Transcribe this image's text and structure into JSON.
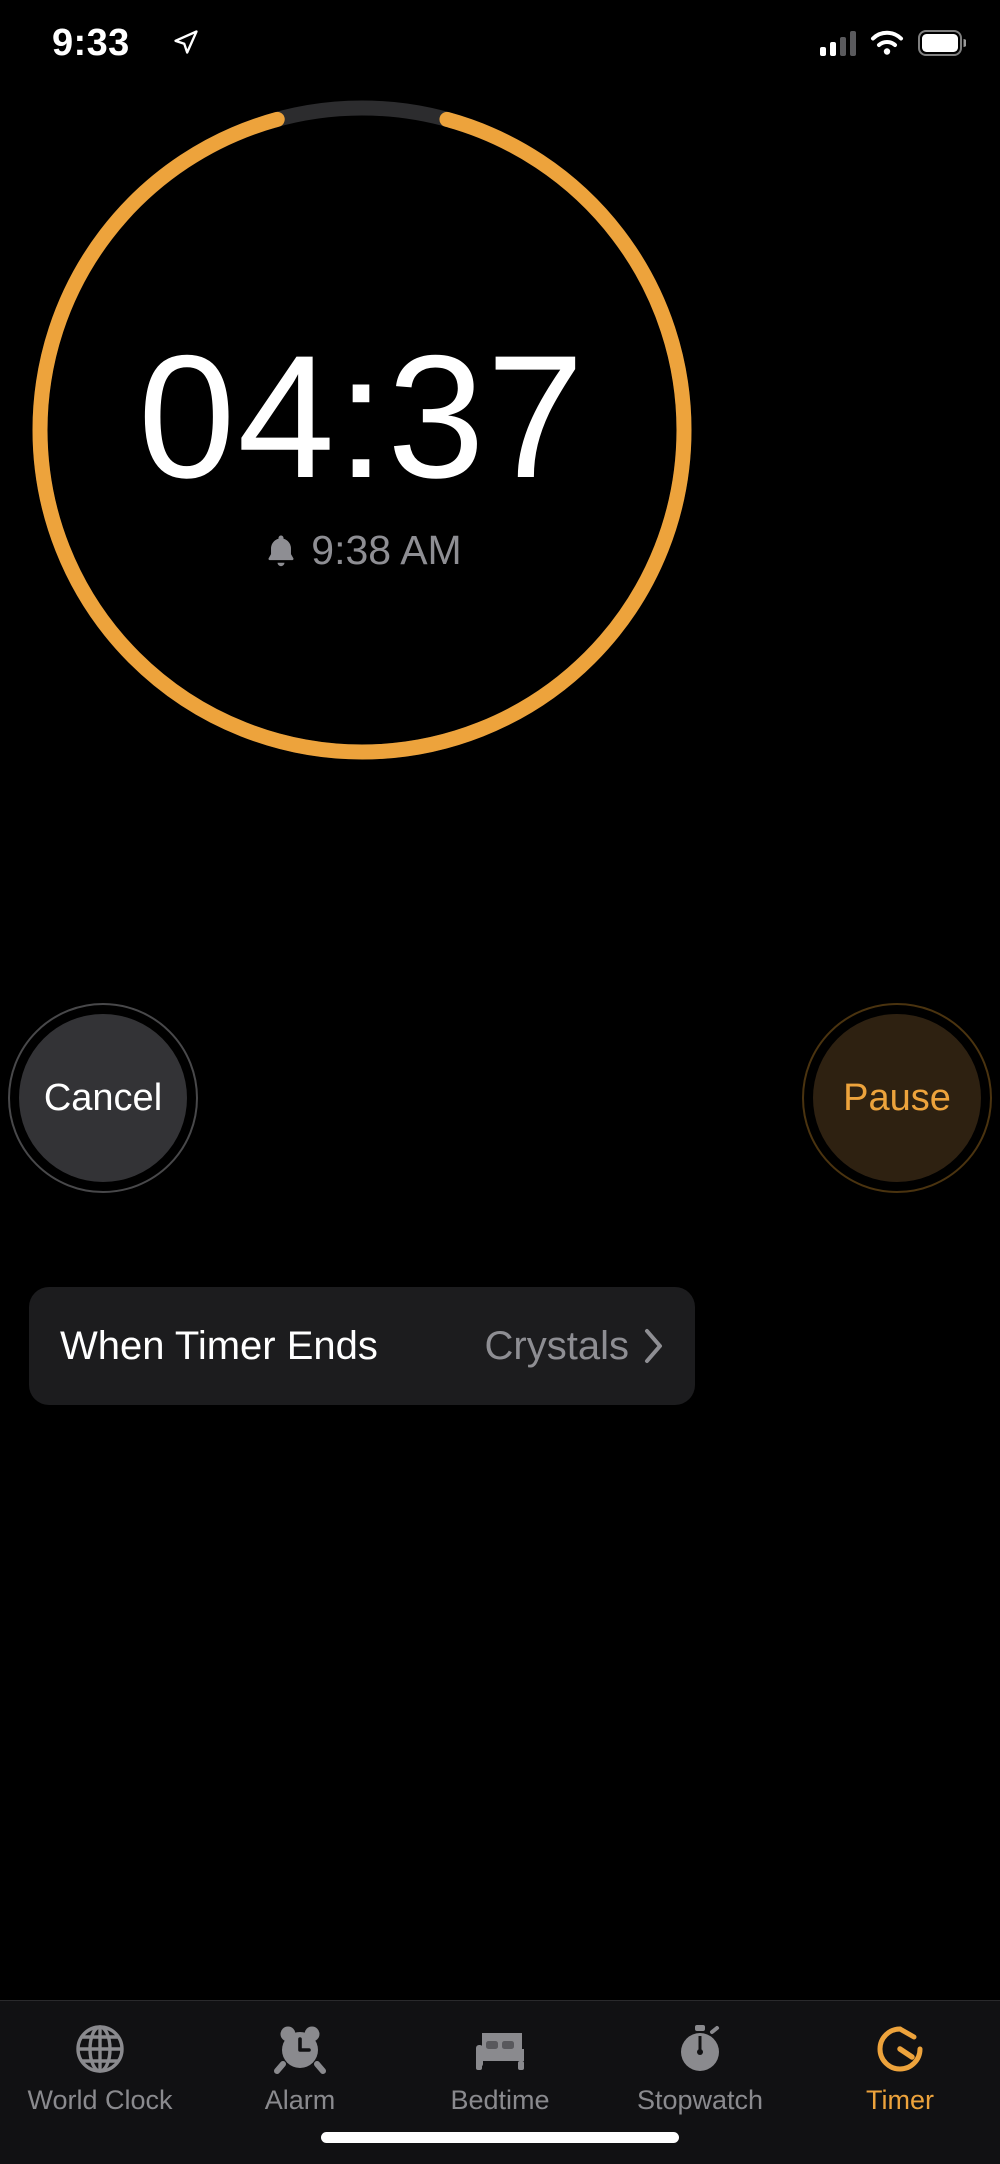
{
  "status_bar": {
    "time": "9:33",
    "location_icon": "location-arrow-icon",
    "cellular_icon": "cellular-signal-icon",
    "cellular_bars_filled": 2,
    "cellular_bars_total": 4,
    "wifi_icon": "wifi-icon",
    "battery_icon": "battery-icon",
    "battery_level_pct": 92
  },
  "timer": {
    "remaining": "04:37",
    "alarm_icon": "bell-icon",
    "alarm_time": "9:38 AM",
    "progress_fraction": 0.915,
    "ring_color": "#eda33c",
    "ring_track_color": "#2c2c2e"
  },
  "controls": {
    "cancel_label": "Cancel",
    "pause_label": "Pause",
    "cancel_text_color": "#ffffff",
    "pause_text_color": "#eda33c",
    "cancel_fill": "#333336",
    "pause_fill": "#2e2111"
  },
  "when_timer_ends": {
    "label": "When Timer Ends",
    "value": "Crystals",
    "chevron_icon": "chevron-right-icon"
  },
  "tab_bar": {
    "active_color": "#eda33c",
    "inactive_color": "#8a8a8e",
    "items": [
      {
        "label": "World Clock",
        "icon": "globe-icon",
        "active": false
      },
      {
        "label": "Alarm",
        "icon": "alarm-clock-icon",
        "active": false
      },
      {
        "label": "Bedtime",
        "icon": "bed-icon",
        "active": false
      },
      {
        "label": "Stopwatch",
        "icon": "stopwatch-icon",
        "active": false
      },
      {
        "label": "Timer",
        "icon": "timer-icon",
        "active": true
      }
    ]
  },
  "home_indicator": "home-indicator"
}
